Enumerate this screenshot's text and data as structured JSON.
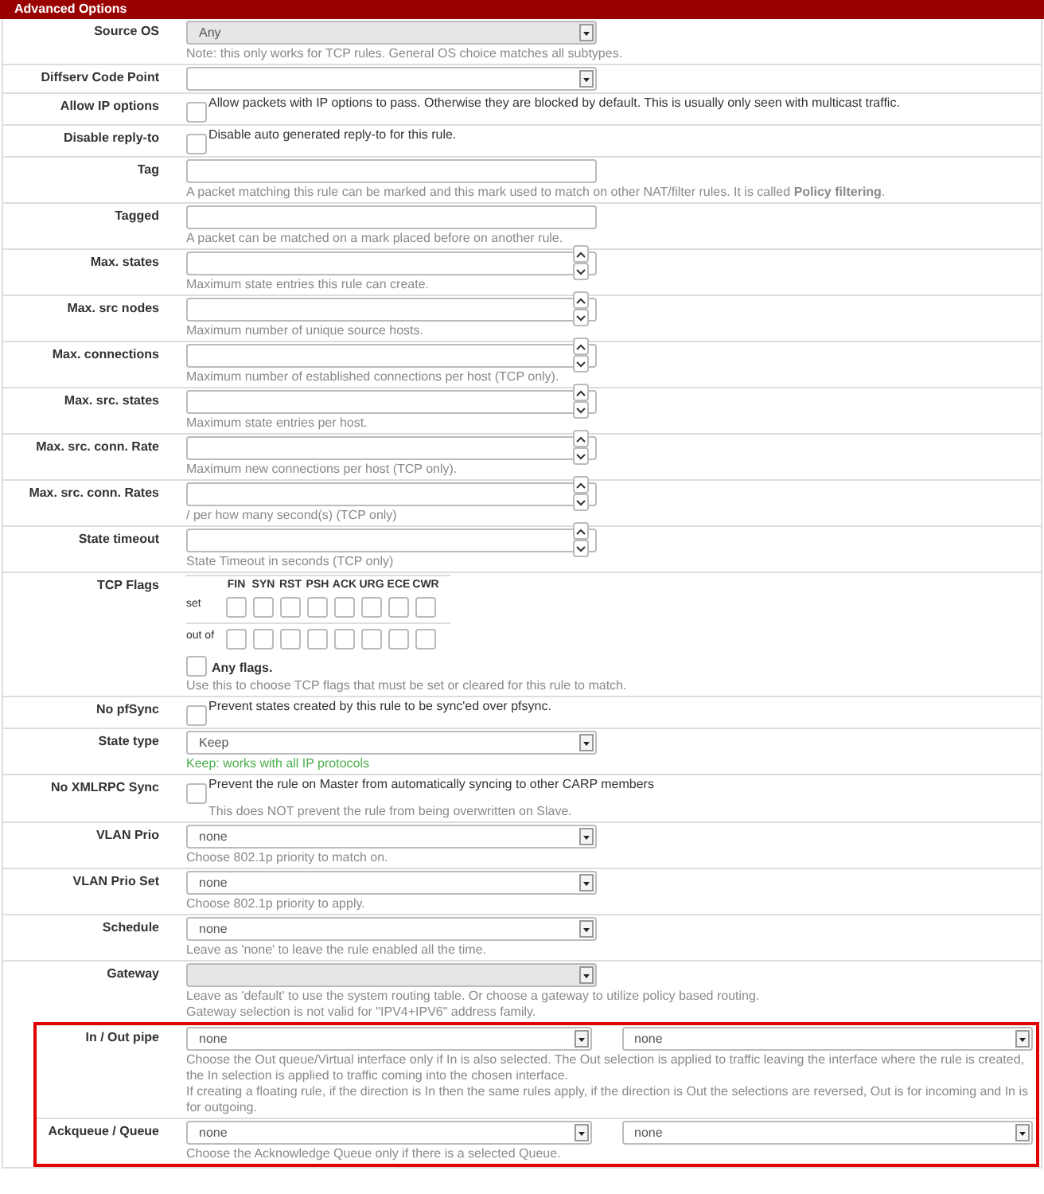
{
  "header": {
    "title": "Advanced Options"
  },
  "rows": [
    {
      "kind": "select",
      "label": "Source OS",
      "value": "Any",
      "disabled": true,
      "note": "Note: this only works for TCP rules. General OS choice matches all subtypes.",
      "success": false,
      "highlighted": false
    },
    {
      "kind": "select",
      "label": "Diffserv Code Point",
      "disabled": false,
      "highlighted": false
    },
    {
      "kind": "checkbox",
      "label": "Allow IP options",
      "checked": false,
      "text": "Allow packets with IP options to pass. Otherwise they are blocked by default. This is usually only seen with multicast traffic.",
      "highlighted": false
    },
    {
      "kind": "checkbox",
      "label": "Disable reply-to",
      "checked": false,
      "text": "Disable auto generated reply-to for this rule.",
      "highlighted": false
    },
    {
      "kind": "text",
      "label": "Tag",
      "note": "A packet matching this rule can be marked and this mark used to match on other NAT/filter rules. It is called **Policy filtering**.",
      "success": false,
      "highlighted": false
    },
    {
      "kind": "text",
      "label": "Tagged",
      "note": "A packet can be matched on a mark placed before on another rule.",
      "success": false,
      "highlighted": false
    },
    {
      "kind": "number",
      "label": "Max. states",
      "note": "Maximum state entries this rule can create.",
      "success": false,
      "highlighted": false
    },
    {
      "kind": "number",
      "label": "Max. src nodes",
      "note": "Maximum number of unique source hosts.",
      "success": false,
      "highlighted": false
    },
    {
      "kind": "number",
      "label": "Max. connections",
      "note": "Maximum number of established connections per host (TCP only).",
      "success": false,
      "highlighted": false
    },
    {
      "kind": "number",
      "label": "Max. src. states",
      "note": "Maximum state entries per host.",
      "success": false,
      "highlighted": false
    },
    {
      "kind": "number",
      "label": "Max. src. conn. Rate",
      "note": "Maximum new connections per host (TCP only).",
      "success": false,
      "highlighted": false
    },
    {
      "kind": "number",
      "label": "Max. src. conn. Rates",
      "note": "/ per how many second(s) (TCP only)",
      "success": false,
      "highlighted": false
    },
    {
      "kind": "number",
      "label": "State timeout",
      "note": "State Timeout in seconds (TCP only)",
      "success": false,
      "highlighted": false
    },
    {
      "kind": "tcpflags",
      "label": "TCP Flags",
      "set_label": "set",
      "out_of_label": "out of",
      "flags": [
        {
          "name": "FIN",
          "set": false,
          "out_of": false
        },
        {
          "name": "SYN",
          "set": false,
          "out_of": false
        },
        {
          "name": "RST",
          "set": false,
          "out_of": false
        },
        {
          "name": "PSH",
          "set": false,
          "out_of": false
        },
        {
          "name": "ACK",
          "set": false,
          "out_of": false
        },
        {
          "name": "URG",
          "set": false,
          "out_of": false
        },
        {
          "name": "ECE",
          "set": false,
          "out_of": false
        },
        {
          "name": "CWR",
          "set": false,
          "out_of": false
        }
      ],
      "any_flags": {
        "label": "Any flags.",
        "checked": false
      },
      "note": "Use this to choose TCP flags that must be set or cleared for this rule to match.",
      "success": false,
      "highlighted": false
    },
    {
      "kind": "checkbox",
      "label": "No pfSync",
      "checked": false,
      "text": "Prevent states created by this rule to be sync'ed over pfsync.",
      "highlighted": false
    },
    {
      "kind": "select",
      "label": "State type",
      "value": "Keep",
      "disabled": false,
      "note": "Keep: works with all IP protocols",
      "success": true,
      "highlighted": false
    },
    {
      "kind": "checkbox",
      "label": "No XMLRPC Sync",
      "checked": false,
      "text": "Prevent the rule on Master from automatically syncing to other CARP members",
      "note": "This does NOT prevent the rule from being overwritten on Slave.",
      "success": false,
      "highlighted": false
    },
    {
      "kind": "select",
      "label": "VLAN Prio",
      "value": "none",
      "disabled": false,
      "note": "Choose 802.1p priority to match on.",
      "success": false,
      "highlighted": false
    },
    {
      "kind": "select",
      "label": "VLAN Prio Set",
      "value": "none",
      "disabled": false,
      "note": "Choose 802.1p priority to apply.",
      "success": false,
      "highlighted": false
    },
    {
      "kind": "select",
      "label": "Schedule",
      "value": "none",
      "disabled": false,
      "note": "Leave as 'none' to leave the rule enabled all the time.",
      "success": false,
      "highlighted": false
    },
    {
      "kind": "select",
      "label": "Gateway",
      "disabled": true,
      "notes": [
        "Leave as 'default' to use the system routing table. Or choose a gateway to utilize policy based routing.",
        "Gateway selection is not valid for \"IPV4+IPV6\" address family."
      ],
      "success": false,
      "highlighted": false
    },
    {
      "kind": "select2",
      "label": "In / Out pipe",
      "values": [
        "none",
        "none"
      ],
      "notes": [
        "Choose the Out queue/Virtual interface only if In is also selected. The Out selection is applied to traffic leaving the interface where the rule is created, the In selection is applied to traffic coming into the chosen interface.",
        "If creating a floating rule, if the direction is In then the same rules apply, if the direction is Out the selections are reversed, Out is for incoming and In is for outgoing."
      ],
      "success": false,
      "highlighted": true
    },
    {
      "kind": "select2",
      "label": "Ackqueue / Queue",
      "values": [
        "none",
        "none"
      ],
      "note": "Choose the Acknowledge Queue only if there is a selected Queue.",
      "success": false,
      "highlighted": true
    }
  ]
}
